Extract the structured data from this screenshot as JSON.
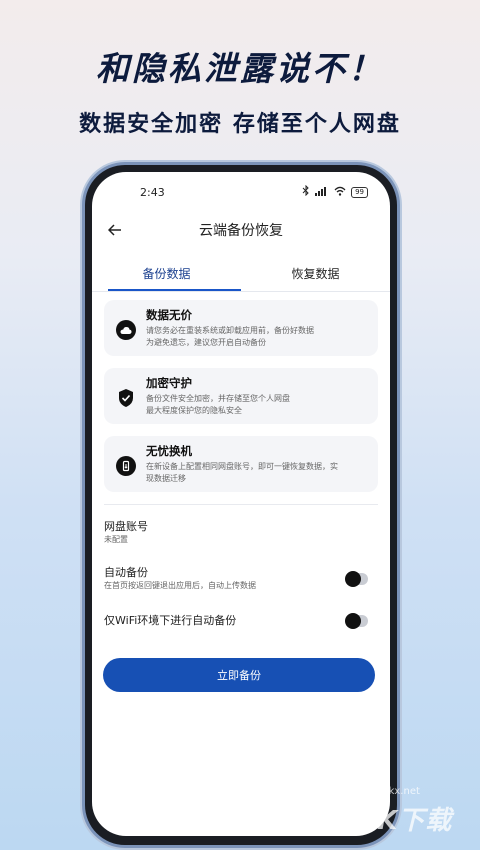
{
  "promo": {
    "headline": "和隐私泄露说不！",
    "subline": "数据安全加密  存储至个人网盘"
  },
  "status_bar": {
    "time": "2:43",
    "battery": "99"
  },
  "header": {
    "title": "云端备份恢复"
  },
  "tabs": [
    {
      "label": "备份数据",
      "active": true
    },
    {
      "label": "恢复数据",
      "active": false
    }
  ],
  "features": [
    {
      "title": "数据无价",
      "desc_line1": "请您务必在重装系统或卸载应用前，备份好数据",
      "desc_line2": "为避免遗忘，建议您开启自动备份",
      "icon": "cloud-icon"
    },
    {
      "title": "加密守护",
      "desc_line1": "备份文件安全加密，并存储至您个人网盘",
      "desc_line2": "最大程度保护您的隐私安全",
      "icon": "shield-check-icon"
    },
    {
      "title": "无忧换机",
      "desc_line1": "在新设备上配置相同网盘账号，即可一键恢复数据，实",
      "desc_line2": "现数据迁移",
      "icon": "phone-transfer-icon"
    }
  ],
  "settings": {
    "account": {
      "label": "网盘账号",
      "value": "未配置"
    },
    "auto_backup": {
      "label": "自动备份",
      "desc": "在首页按返回键退出应用后，自动上传数据",
      "enabled": false
    },
    "wifi_only": {
      "label": "仅WiFi环境下进行自动备份",
      "enabled": false
    }
  },
  "actions": {
    "backup_now": "立即备份"
  },
  "watermark": {
    "url": "www.kkx.net",
    "logo": "KK下载"
  },
  "colors": {
    "accent": "#1750b4",
    "headline": "#0d1b3d"
  }
}
